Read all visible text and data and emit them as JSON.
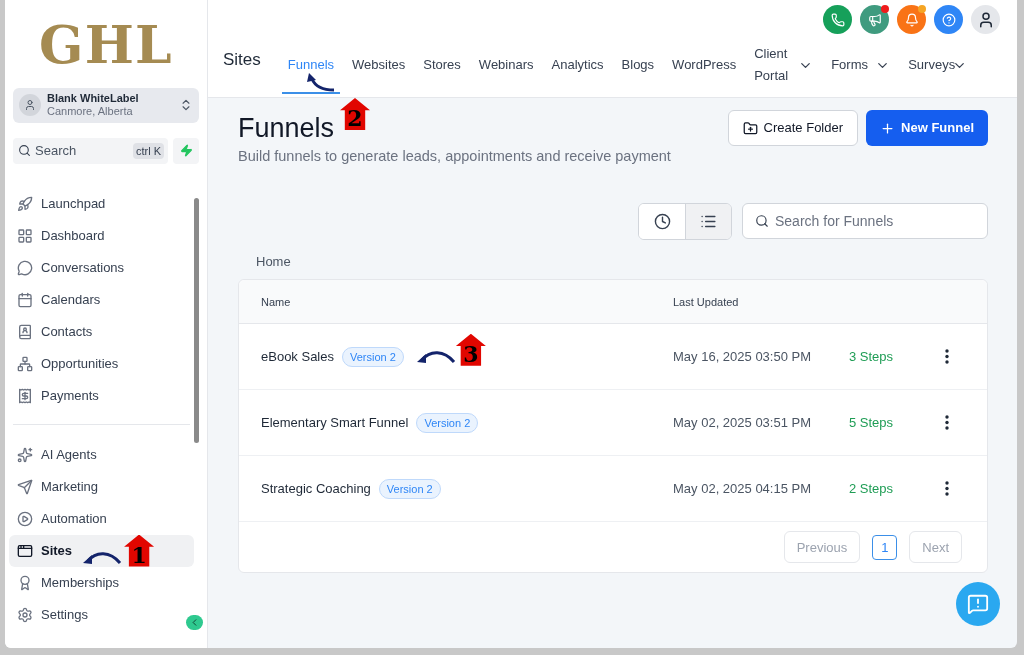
{
  "sidebar": {
    "logo": "GHL",
    "account": {
      "name": "Blank WhiteLabel",
      "location": "Canmore, Alberta"
    },
    "search": {
      "placeholder": "Search",
      "shortcut": "ctrl K"
    },
    "groups": [
      {
        "items": [
          {
            "kind": "launchpad",
            "label": "Launchpad",
            "selected": false
          },
          {
            "kind": "dashboard",
            "label": "Dashboard",
            "selected": false
          },
          {
            "kind": "conversations",
            "label": "Conversations",
            "selected": false
          },
          {
            "kind": "calendars",
            "label": "Calendars",
            "selected": false
          },
          {
            "kind": "contacts",
            "label": "Contacts",
            "selected": false
          },
          {
            "kind": "opportunities",
            "label": "Opportunities",
            "selected": false
          },
          {
            "kind": "payments",
            "label": "Payments",
            "selected": false
          }
        ]
      },
      {
        "items": [
          {
            "kind": "ai",
            "label": "AI Agents",
            "selected": false
          },
          {
            "kind": "marketing",
            "label": "Marketing",
            "selected": false
          },
          {
            "kind": "automation",
            "label": "Automation",
            "selected": false
          },
          {
            "kind": "sites",
            "label": "Sites",
            "selected": true,
            "callout": "1"
          },
          {
            "kind": "memberships",
            "label": "Memberships",
            "selected": false
          },
          {
            "kind": "settings",
            "label": "Settings",
            "selected": false
          }
        ]
      }
    ]
  },
  "header": {
    "section": "Sites",
    "tabs": [
      {
        "label": "Funnels",
        "selected": true,
        "callout": "2"
      },
      {
        "label": "Websites",
        "selected": false
      },
      {
        "label": "Stores",
        "selected": false
      },
      {
        "label": "Webinars",
        "selected": false
      },
      {
        "label": "Analytics",
        "selected": false
      },
      {
        "label": "Blogs",
        "selected": false
      },
      {
        "label": "WordPress",
        "selected": false
      },
      {
        "label": "Client Portal",
        "selected": false,
        "dropdown": true
      },
      {
        "label": "Forms",
        "selected": false,
        "dropdown": true
      },
      {
        "label": "Surveys",
        "selected": false,
        "dropdown": true
      }
    ],
    "actions": [
      {
        "kind": "phone",
        "color": "#16a05a",
        "dot": false
      },
      {
        "kind": "megaphone",
        "color": "#3f9b7f",
        "dot": true
      },
      {
        "kind": "bell",
        "color": "#f97316",
        "dot": true
      },
      {
        "kind": "help",
        "color": "#2f86f6",
        "dot": false
      }
    ]
  },
  "page": {
    "title": "Funnels",
    "subtitle": "Build funnels to generate leads, appointments and receive payment",
    "buttons": [
      {
        "kind": "secondary",
        "label": "Create Folder"
      },
      {
        "kind": "primary",
        "label": "New Funnel"
      }
    ],
    "search": {
      "placeholder": "Search for Funnels"
    },
    "view_toggle": [
      {
        "kind": "recent",
        "selected": false
      },
      {
        "kind": "list",
        "selected": true
      }
    ],
    "breadcrumb": "Home",
    "table": {
      "columns": [
        "Name",
        "Last Updated"
      ],
      "rows": [
        {
          "name": "eBook Sales",
          "badge": "Version 2",
          "updated": "May 16, 2025 03:50 PM",
          "steps": "3 Steps",
          "callout": "3"
        },
        {
          "name": "Elementary Smart Funnel",
          "badge": "Version 2",
          "updated": "May 02, 2025 03:51 PM",
          "steps": "5 Steps"
        },
        {
          "name": "Strategic Coaching",
          "badge": "Version 2",
          "updated": "May 02, 2025 04:15 PM",
          "steps": "2 Steps"
        }
      ]
    },
    "pagination": {
      "previous": "Previous",
      "pages": [
        {
          "label": "1",
          "selected": true
        }
      ],
      "next": "Next"
    }
  }
}
